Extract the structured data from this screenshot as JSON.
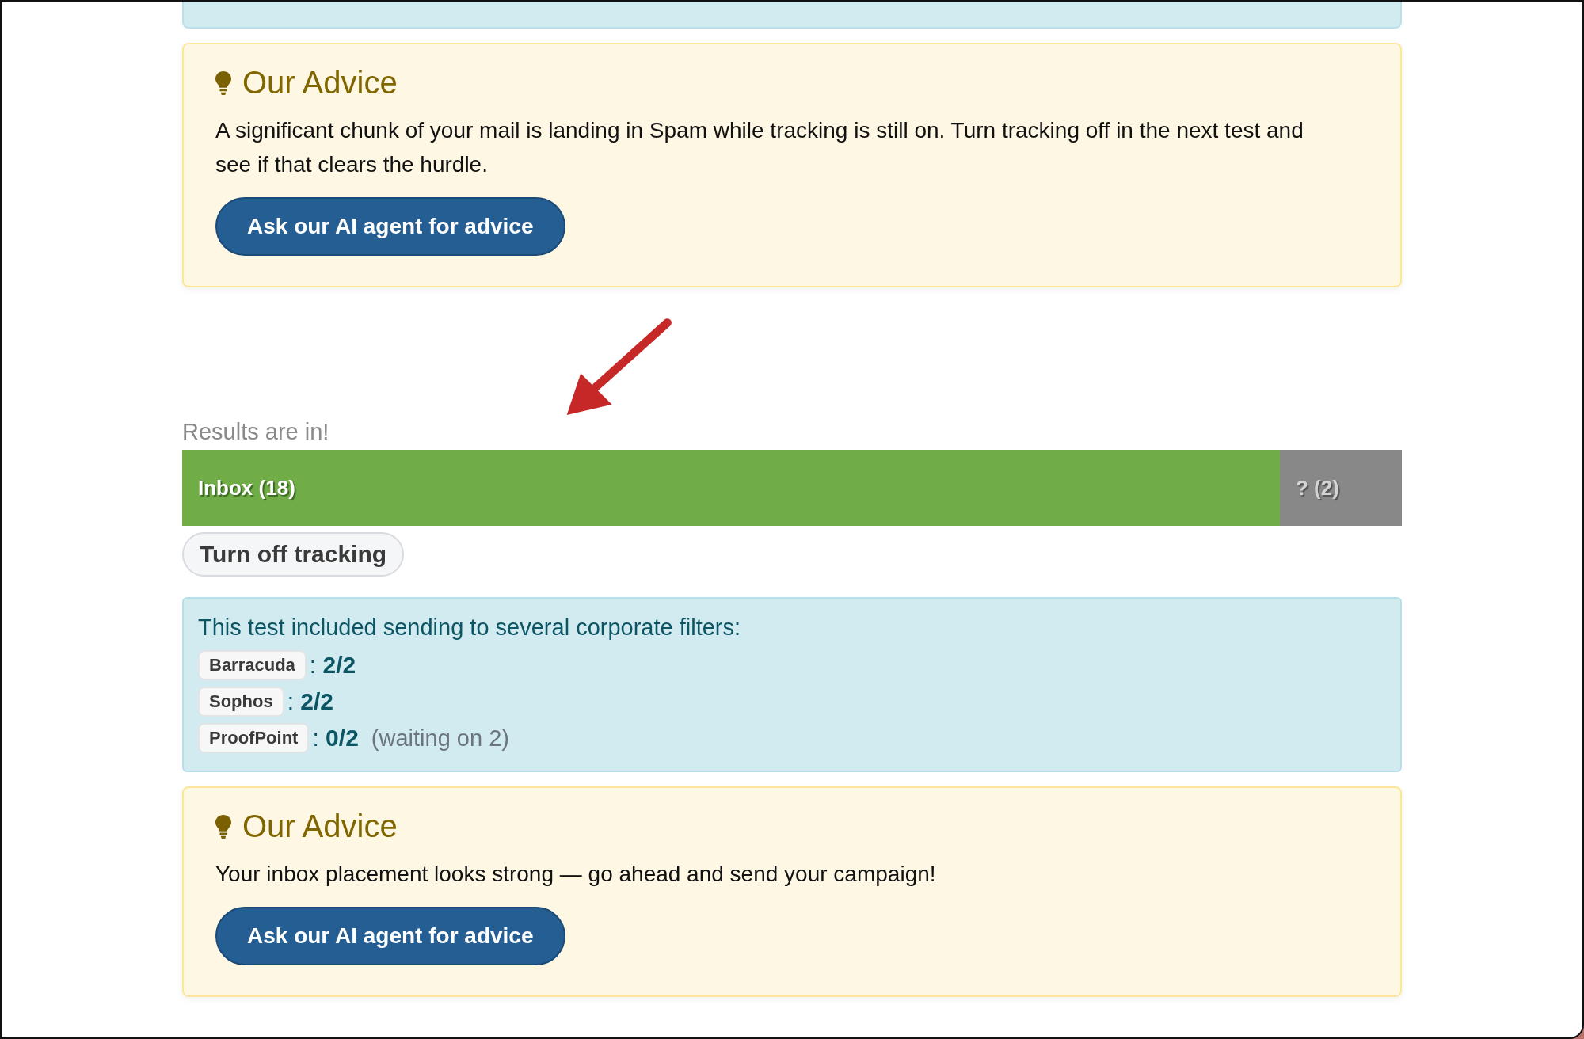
{
  "advice_top": {
    "title": "Our Advice",
    "text": "A significant chunk of your mail is landing in Spam while tracking is still on. Turn tracking off in the next test and see if that clears the hurdle.",
    "button": "Ask our AI agent for advice"
  },
  "results": {
    "label": "Results are in!",
    "placement_bar": [
      {
        "label": "Inbox (18)",
        "color": "#70ad47"
      },
      {
        "label": "? (2)",
        "color": "#888888"
      }
    ],
    "action_button": "Turn off tracking"
  },
  "filters": {
    "intro": "This test included sending to several corporate filters:",
    "items": [
      {
        "name": "Barracuda",
        "score": ": **2/2**"
      },
      {
        "name": "Sophos",
        "score": ": **2/2**"
      },
      {
        "name": "ProofPoint",
        "score": ": **0/2**",
        "note": "(waiting on 2)"
      }
    ]
  },
  "advice_bottom": {
    "title": "Our Advice",
    "text": "Your inbox placement looks strong — go ahead and send your campaign!",
    "button": "Ask our AI agent for advice"
  }
}
